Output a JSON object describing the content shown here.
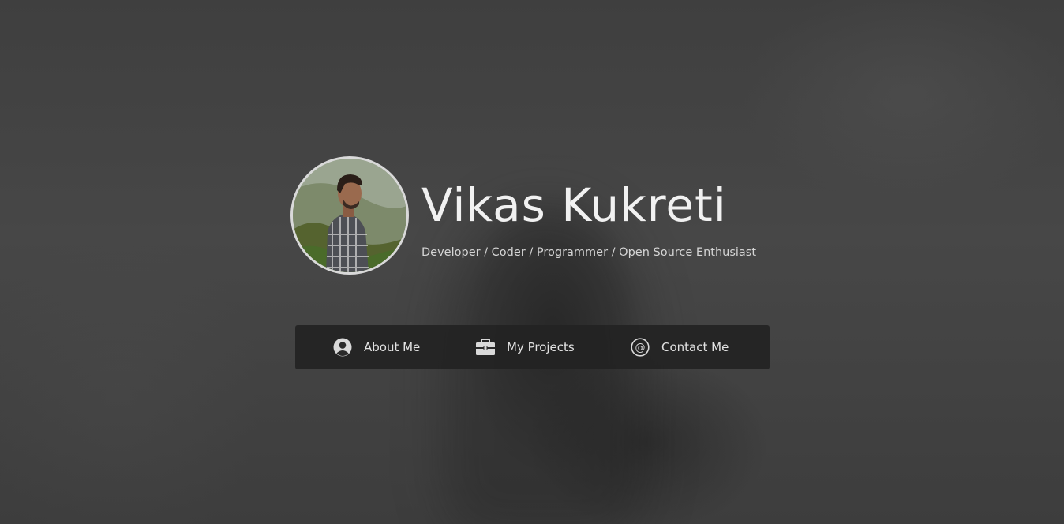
{
  "profile": {
    "name": "Vikas Kukreti",
    "tagline": "Developer / Coder / Programmer / Open Source Enthusiast"
  },
  "nav": {
    "items": [
      {
        "label": "About Me",
        "icon": "user-circle-icon"
      },
      {
        "label": "My Projects",
        "icon": "briefcase-icon"
      },
      {
        "label": "Contact Me",
        "icon": "at-sign-icon"
      }
    ]
  },
  "colors": {
    "background": "#444444",
    "nav_background": "#222222",
    "text": "#f1f1f1",
    "avatar_border": "#d9d9d9"
  }
}
